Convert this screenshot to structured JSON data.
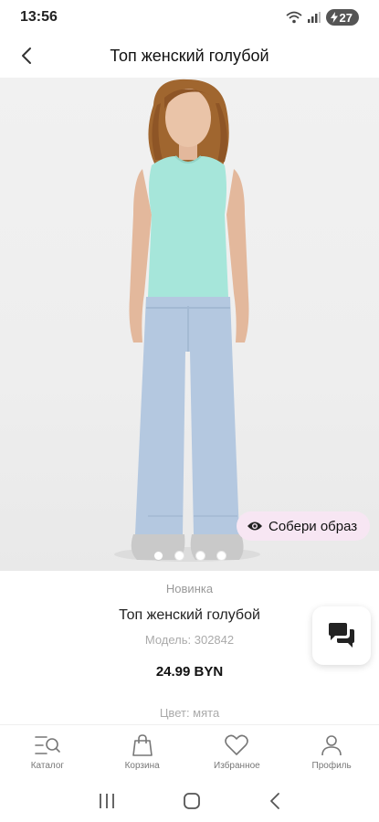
{
  "status_bar": {
    "time": "13:56",
    "battery": "27"
  },
  "header": {
    "title": "Топ женский голубой"
  },
  "hero": {
    "outfit_button": "Собери образ",
    "carousel": {
      "total": 4,
      "active_index": 0
    }
  },
  "product": {
    "badge": "Новинка",
    "name": "Топ женский голубой",
    "model": "Модель: 302842",
    "price": "24.99 BYN",
    "color": "Цвет: мята"
  },
  "bottom_nav": [
    {
      "label": "Каталог",
      "icon": "catalog-icon"
    },
    {
      "label": "Корзина",
      "icon": "bag-icon"
    },
    {
      "label": "Избранное",
      "icon": "heart-icon"
    },
    {
      "label": "Профиль",
      "icon": "person-icon"
    }
  ],
  "colors": {
    "outfit_button_bg": "#f7e6f3",
    "top_color": "#a6e6da",
    "jeans_color": "#b4c8e0"
  }
}
